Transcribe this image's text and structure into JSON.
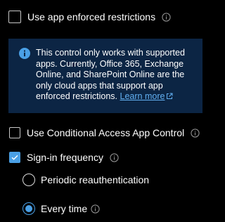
{
  "options": {
    "app_enforced": {
      "label": "Use app enforced restrictions",
      "checked": false
    },
    "conditional_access": {
      "label": "Use Conditional Access App Control",
      "checked": false
    },
    "signin_frequency": {
      "label": "Sign-in frequency",
      "checked": true
    }
  },
  "banner": {
    "text": "This control only works with supported apps. Currently, Office 365, Exchange Online, and SharePoint Online are the only cloud apps that support app enforced restrictions.",
    "link_label": "Learn more"
  },
  "frequency_choices": [
    {
      "label": "Periodic reauthentication",
      "selected": false
    },
    {
      "label": "Every time",
      "selected": true
    }
  ],
  "colors": {
    "accent": "#4aa0e6",
    "banner_background": "#0c2544",
    "link": "#62b0f2",
    "info_icon": "#9a9a9a"
  },
  "icons": {
    "info_outline": "info-icon",
    "info_filled": "info-circle-filled-icon",
    "external_link": "external-link-icon",
    "checkmark": "checkmark-icon"
  }
}
